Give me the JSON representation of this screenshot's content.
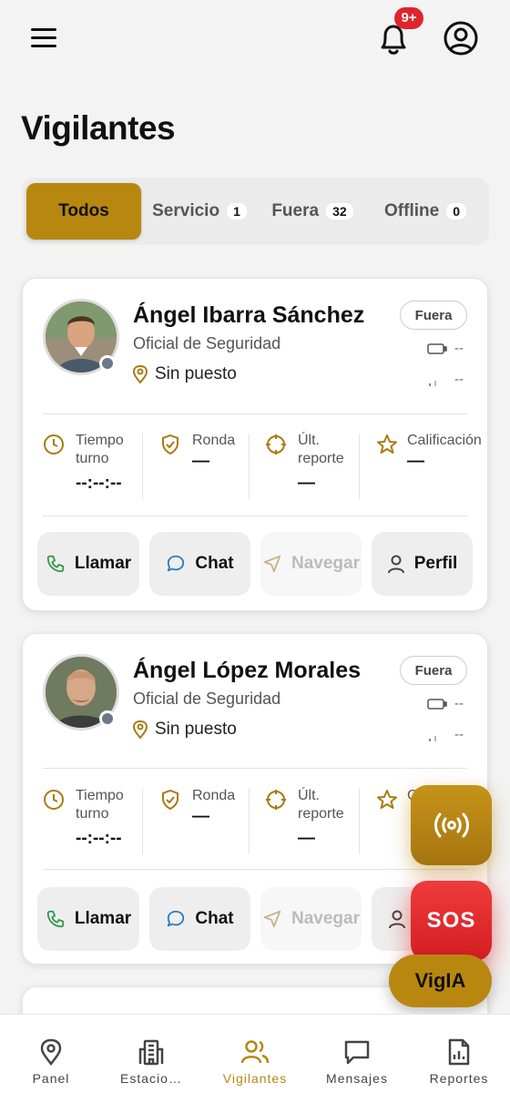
{
  "header": {
    "notification_badge": "9+"
  },
  "page": {
    "title": "Vigilantes"
  },
  "tabs": [
    {
      "label": "Todos",
      "count": ""
    },
    {
      "label": "Servicio",
      "count": "1"
    },
    {
      "label": "Fuera",
      "count": "32"
    },
    {
      "label": "Offline",
      "count": "0"
    }
  ],
  "guards": [
    {
      "name": "Ángel Ibarra Sánchez",
      "role": "Oficial de Seguridad",
      "location": "Sin puesto",
      "status": "Fuera",
      "battery": "--",
      "signal": "--",
      "stats": [
        {
          "label_1": "Tiempo",
          "label_2": "turno",
          "value": "--:--:--"
        },
        {
          "label_1": "Ronda",
          "label_2": "",
          "value": "—"
        },
        {
          "label_1": "Últ.",
          "label_2": "reporte",
          "value": "—"
        },
        {
          "label_1": "Calificación",
          "label_2": "",
          "value": "—"
        }
      ],
      "actions": {
        "call": "Llamar",
        "chat": "Chat",
        "navigate": "Navegar",
        "profile": "Perfil"
      }
    },
    {
      "name": "Ángel López Morales",
      "role": "Oficial de Seguridad",
      "location": "Sin puesto",
      "status": "Fuera",
      "battery": "--",
      "signal": "--",
      "stats": [
        {
          "label_1": "Tiempo",
          "label_2": "turno",
          "value": "--:--:--"
        },
        {
          "label_1": "Ronda",
          "label_2": "",
          "value": "—"
        },
        {
          "label_1": "Últ.",
          "label_2": "reporte",
          "value": "—"
        },
        {
          "label_1": "C",
          "label_2": "",
          "value": ""
        }
      ],
      "actions": {
        "call": "Llamar",
        "chat": "Chat",
        "navigate": "Navegar",
        "profile": ""
      }
    }
  ],
  "fab": {
    "sos_label": "SOS",
    "vigia_label": "VigIA"
  },
  "bottom_nav": [
    {
      "label": "Panel",
      "icon": "map-pin-icon"
    },
    {
      "label": "Estacio…",
      "icon": "building-icon"
    },
    {
      "label": "Vigilantes",
      "icon": "users-icon"
    },
    {
      "label": "Mensajes",
      "icon": "message-icon"
    },
    {
      "label": "Reportes",
      "icon": "report-icon"
    }
  ],
  "colors": {
    "accent": "#b8870f",
    "sos": "#e0242c",
    "background": "#f3f3f3"
  }
}
